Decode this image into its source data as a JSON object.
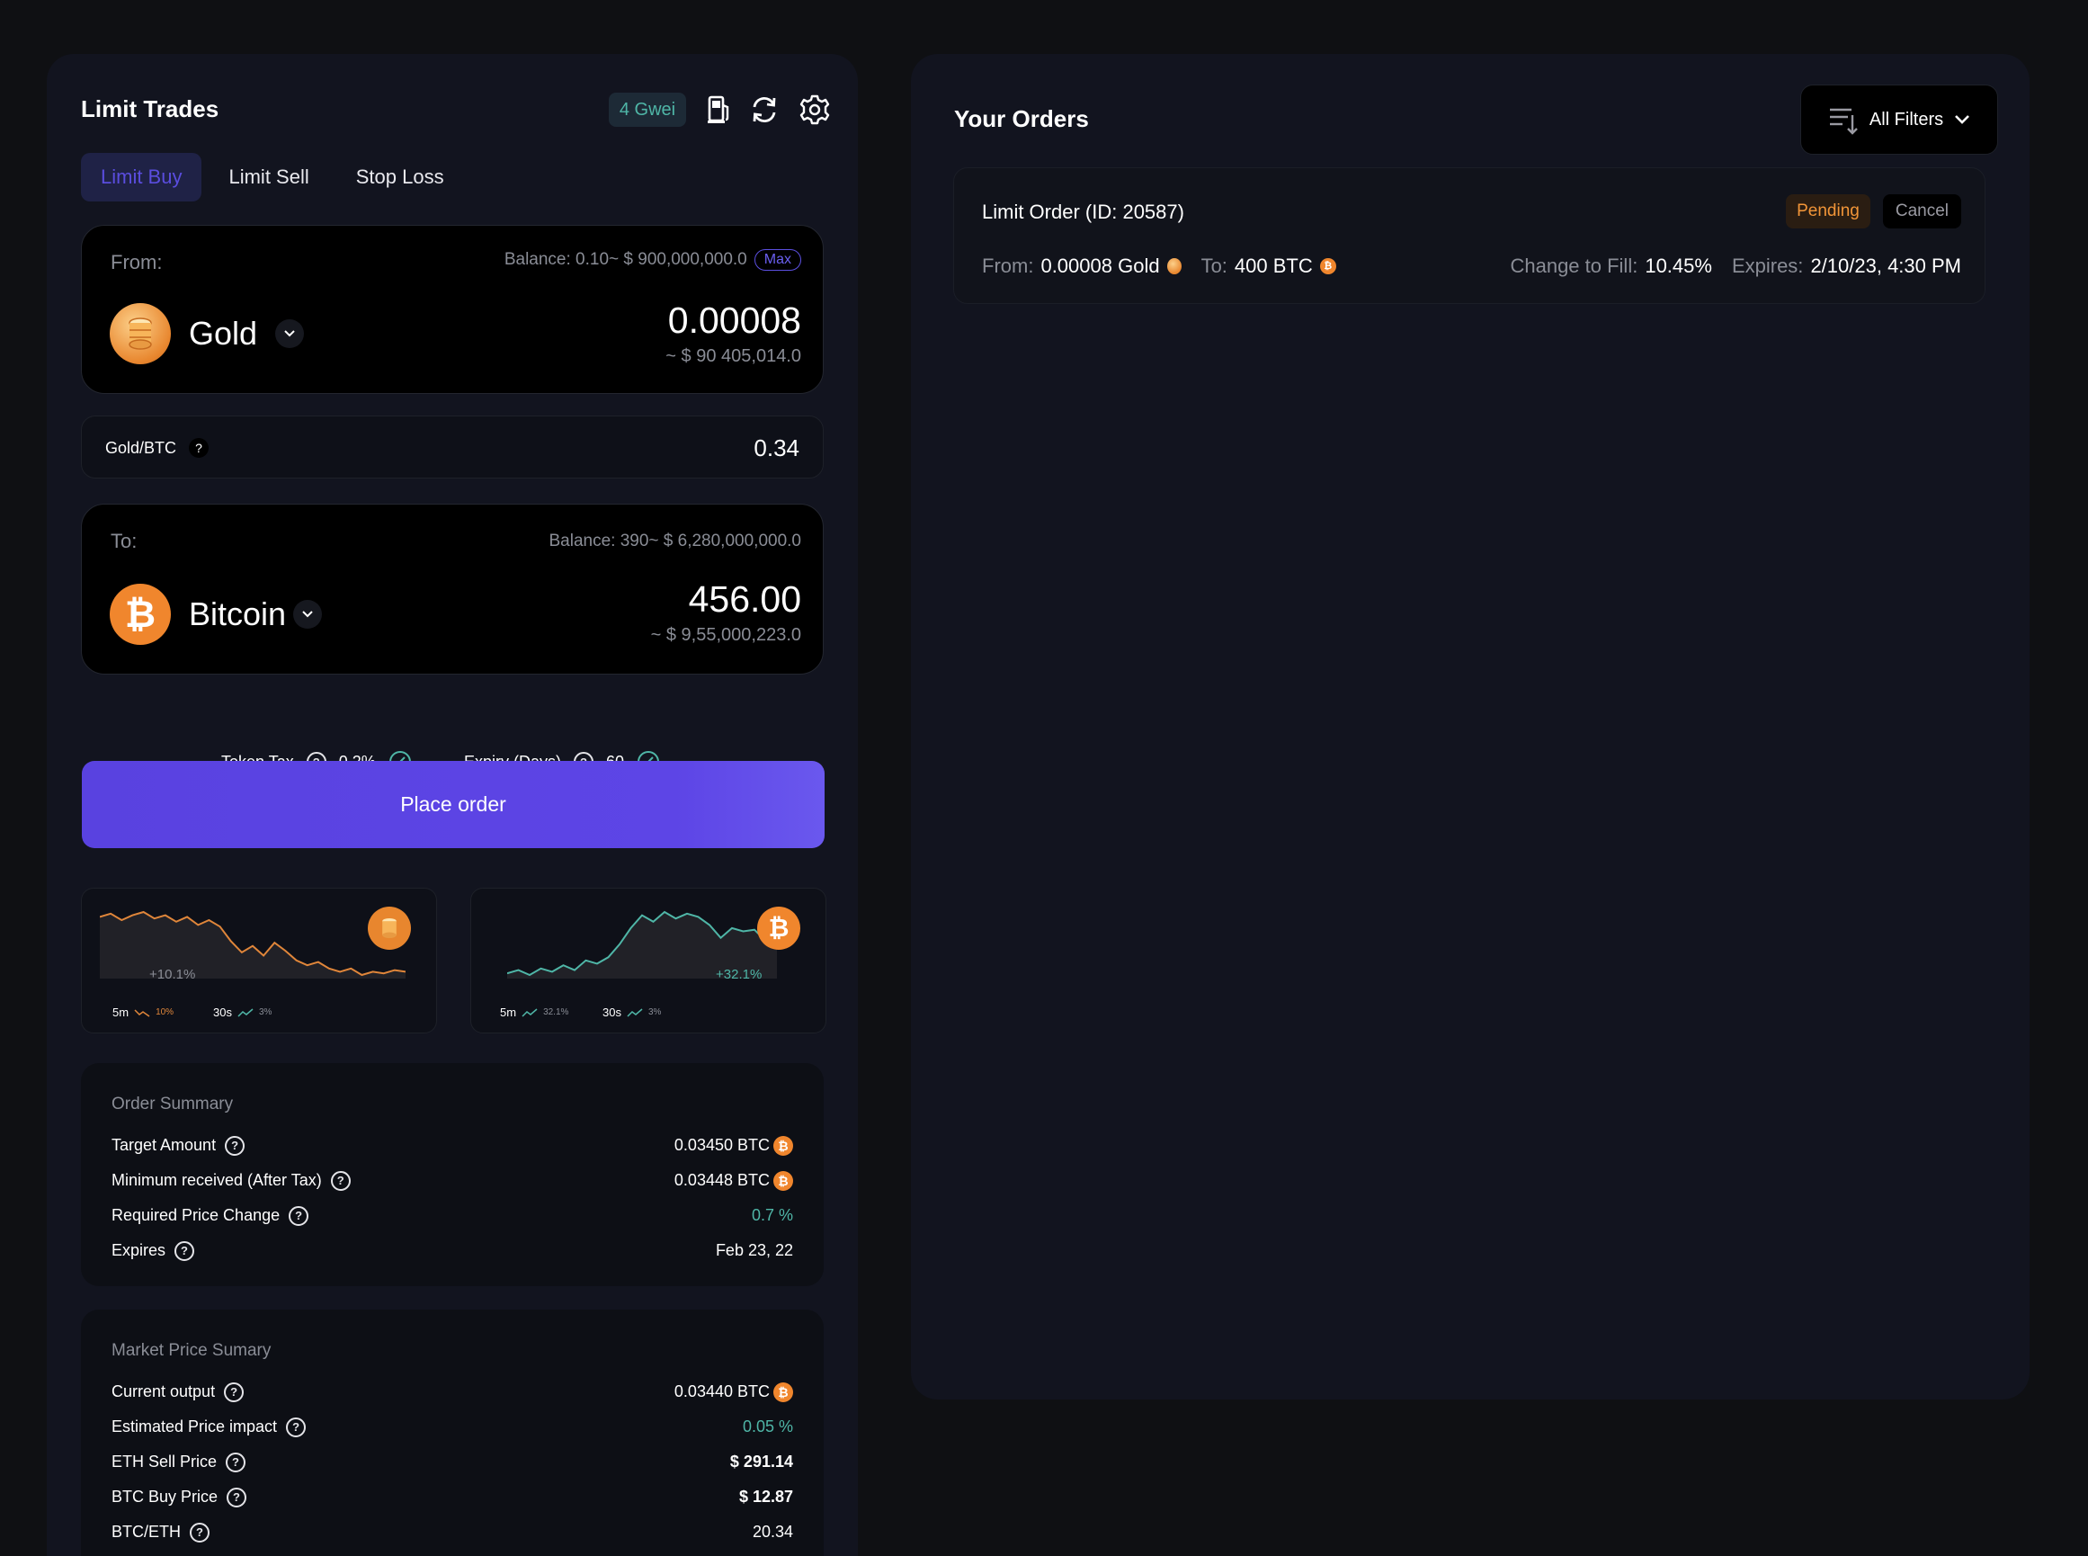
{
  "trade_panel": {
    "title": "Limit Trades",
    "gas": "4 Gwei",
    "tabs": [
      {
        "label": "Limit Buy",
        "active": true
      },
      {
        "label": "Limit Sell",
        "active": false
      },
      {
        "label": "Stop Loss",
        "active": false
      }
    ],
    "from": {
      "label": "From:",
      "balance": "Balance: 0.10~ $ 900,000,000.0",
      "max_label": "Max",
      "token": "Gold",
      "amount": "0.00008",
      "fiat": "~ $ 90 405,014.0"
    },
    "rate": {
      "pair": "Gold/BTC",
      "help": "?",
      "value": "0.34"
    },
    "to": {
      "label": "To:",
      "balance": "Balance: 390~ $ 6,280,000,000.0",
      "token": "Bitcoin",
      "amount": "456.00",
      "fiat": "~ $ 9,55,000,223.0"
    },
    "params": {
      "tax_label": "Token Tax",
      "tax_value": "0.2%",
      "expiry_label": "Expiry (Days)",
      "expiry_value": "60"
    },
    "place_order_label": "Place order",
    "charts": [
      {
        "coin": "gold",
        "change": "+10.1%",
        "frame1_label": "5m",
        "frame1_value": "10%",
        "frame2_label": "30s",
        "frame2_value": "3%",
        "line_color": "#e0863a",
        "series": [
          60,
          62,
          58,
          61,
          63,
          59,
          61,
          57,
          60,
          55,
          58,
          54,
          45,
          38,
          42,
          36,
          44,
          39,
          33,
          30,
          32,
          28,
          26,
          28,
          24,
          26,
          25,
          27,
          26
        ]
      },
      {
        "coin": "btc",
        "change": "+32.1%",
        "frame1_label": "5m",
        "frame1_value": "32.1%",
        "frame2_label": "30s",
        "frame2_value": "3%",
        "line_color": "#4fb6a7",
        "series": [
          22,
          24,
          21,
          25,
          23,
          27,
          24,
          30,
          28,
          32,
          40,
          50,
          58,
          54,
          60,
          56,
          59,
          57,
          52,
          44,
          50,
          48,
          49,
          42,
          46
        ]
      }
    ],
    "order_summary": {
      "title": "Order Summary",
      "rows": [
        {
          "label": "Target Amount",
          "value": "0.03450 BTC",
          "btc": true,
          "accent": false
        },
        {
          "label": "Minimum received (After Tax)",
          "value": "0.03448 BTC",
          "btc": true,
          "accent": false
        },
        {
          "label": "Required Price Change",
          "value": "0.7 %",
          "btc": false,
          "accent": true
        },
        {
          "label": "Expires",
          "value": "Feb 23, 22",
          "btc": false,
          "accent": false
        }
      ]
    },
    "market_summary": {
      "title": "Market Price Sumary",
      "rows": [
        {
          "label": "Current output",
          "value": "0.03440 BTC",
          "btc": true,
          "accent": false
        },
        {
          "label": "Estimated Price impact",
          "value": "0.05 %",
          "btc": false,
          "accent": true
        },
        {
          "label": "ETH Sell Price",
          "value": "$ 291.14",
          "btc": false,
          "accent": false
        },
        {
          "label": "BTC Buy Price",
          "value": "$ 12.87",
          "btc": false,
          "accent": false
        },
        {
          "label": "BTC/ETH",
          "value": "20.34",
          "btc": false,
          "accent": false
        }
      ]
    }
  },
  "orders_panel": {
    "title": "Your Orders",
    "filter_label": "All Filters",
    "orders": [
      {
        "title": "Limit Order (ID: 20587)",
        "status": "Pending",
        "cancel_label": "Cancel",
        "from_label": "From:",
        "from_value": "0.00008 Gold",
        "to_label": "To:",
        "to_value": "400 BTC",
        "fill_label": "Change to Fill:",
        "fill_value": "10.45%",
        "expires_label": "Expires:",
        "expires_value": "2/10/23, 4:30 PM"
      }
    ]
  },
  "colors": {
    "background": "#0f1013",
    "panel": "#12141f",
    "accent_purple": "#5942e0",
    "accent_teal": "#4fb6a7",
    "accent_orange": "#f0862d"
  }
}
